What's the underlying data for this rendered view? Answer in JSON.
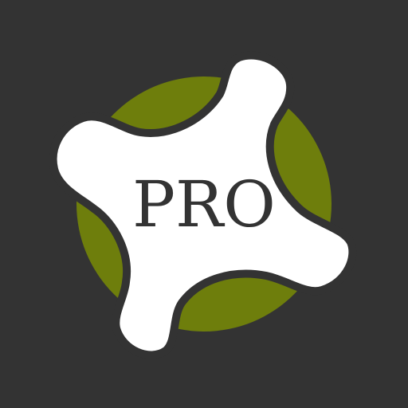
{
  "logo": {
    "text": "PRO",
    "background_color": "#333333",
    "circle_color": "#6E7E0C",
    "shape_color": "#FFFFFF",
    "outline_color": "#333333",
    "text_color": "#333333",
    "icon_name": "pro-logo-icon"
  }
}
